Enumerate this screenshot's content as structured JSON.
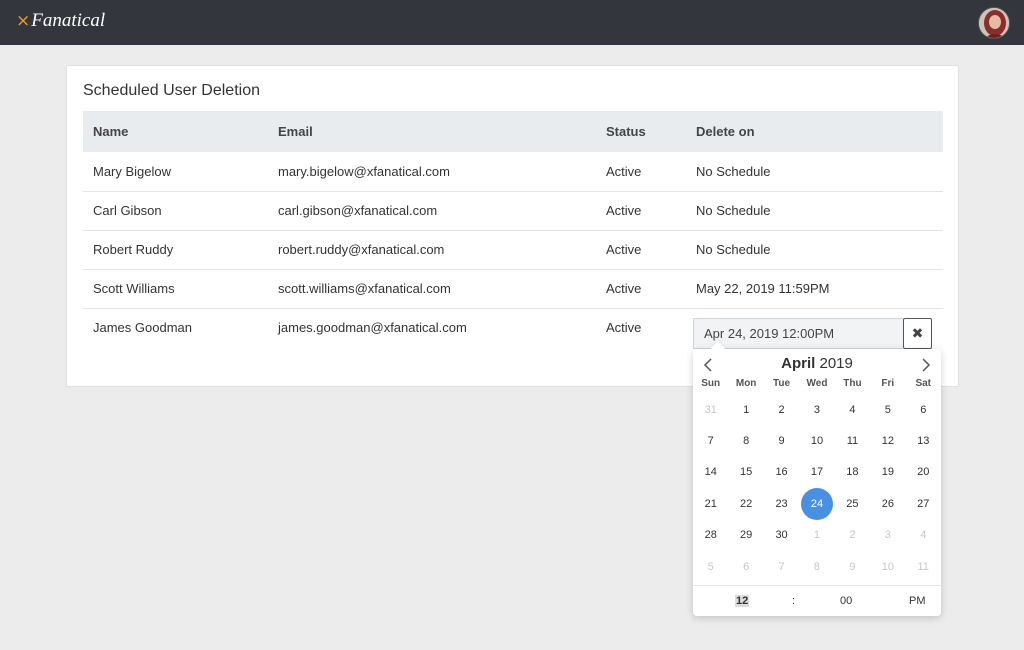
{
  "app": {
    "logo_mark": "×",
    "logo_text": "Fanatical"
  },
  "card": {
    "title": "Scheduled User Deletion"
  },
  "table": {
    "headers": {
      "name": "Name",
      "email": "Email",
      "status": "Status",
      "delete_on": "Delete on"
    },
    "rows": [
      {
        "name": "Mary Bigelow",
        "email": "mary.bigelow@xfanatical.com",
        "status": "Active",
        "delete_on": "No Schedule"
      },
      {
        "name": "Carl Gibson",
        "email": "carl.gibson@xfanatical.com",
        "status": "Active",
        "delete_on": "No Schedule"
      },
      {
        "name": "Robert Ruddy",
        "email": "robert.ruddy@xfanatical.com",
        "status": "Active",
        "delete_on": "No Schedule"
      },
      {
        "name": "Scott Williams",
        "email": "scott.williams@xfanatical.com",
        "status": "Active",
        "delete_on": "May 22, 2019 11:59PM"
      },
      {
        "name": "James Goodman",
        "email": "james.goodman@xfanatical.com",
        "status": "Active",
        "delete_on": ""
      }
    ]
  },
  "date_input": {
    "value": "Apr 24, 2019 12:00PM",
    "clear_label": "✖"
  },
  "calendar": {
    "month": "April",
    "year": "2019",
    "weekdays": [
      "Sun",
      "Mon",
      "Tue",
      "Wed",
      "Thu",
      "Fri",
      "Sat"
    ],
    "days": [
      {
        "d": "31",
        "muted": true
      },
      {
        "d": "1"
      },
      {
        "d": "2"
      },
      {
        "d": "3"
      },
      {
        "d": "4"
      },
      {
        "d": "5"
      },
      {
        "d": "6"
      },
      {
        "d": "7"
      },
      {
        "d": "8"
      },
      {
        "d": "9"
      },
      {
        "d": "10"
      },
      {
        "d": "11"
      },
      {
        "d": "12"
      },
      {
        "d": "13"
      },
      {
        "d": "14"
      },
      {
        "d": "15"
      },
      {
        "d": "16"
      },
      {
        "d": "17"
      },
      {
        "d": "18"
      },
      {
        "d": "19"
      },
      {
        "d": "20"
      },
      {
        "d": "21"
      },
      {
        "d": "22"
      },
      {
        "d": "23"
      },
      {
        "d": "24",
        "selected": true
      },
      {
        "d": "25"
      },
      {
        "d": "26"
      },
      {
        "d": "27"
      },
      {
        "d": "28"
      },
      {
        "d": "29"
      },
      {
        "d": "30"
      },
      {
        "d": "1",
        "muted": true
      },
      {
        "d": "2",
        "muted": true
      },
      {
        "d": "3",
        "muted": true
      },
      {
        "d": "4",
        "muted": true
      },
      {
        "d": "5",
        "muted": true
      },
      {
        "d": "6",
        "muted": true
      },
      {
        "d": "7",
        "muted": true
      },
      {
        "d": "8",
        "muted": true
      },
      {
        "d": "9",
        "muted": true
      },
      {
        "d": "10",
        "muted": true
      },
      {
        "d": "11",
        "muted": true
      }
    ],
    "time": {
      "hour": "12",
      "separator": ":",
      "minute": "00",
      "ampm": "PM"
    }
  },
  "colors": {
    "topbar": "#33373d",
    "accent": "#f29a2e",
    "selected_day": "#4a90e2"
  }
}
